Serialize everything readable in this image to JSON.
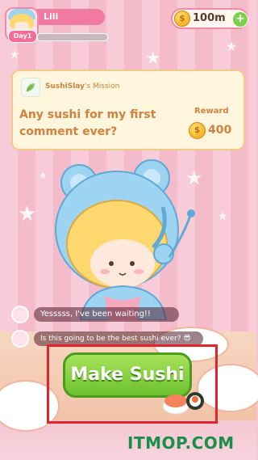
{
  "player": {
    "name": "Lili",
    "day": "Day1"
  },
  "currency": {
    "amount": "100m",
    "add_label": "+"
  },
  "mission": {
    "author": "SushiSlay",
    "title_suffix": "'s Mission",
    "text": "Any sushi for my first comment ever?",
    "reward_label": "Reward",
    "reward_value": "400"
  },
  "comments": [
    {
      "text": "Yesssss, I've been waiting!!"
    },
    {
      "text": "Is this going to be the best sushi ever? 😎"
    }
  ],
  "actions": {
    "make_sushi": "Make Sushi"
  },
  "watermark": "ITMOP.COM",
  "colors": {
    "accent": "#f07aa0",
    "button": "#7fcf4e",
    "mission_text": "#d2813f",
    "highlight": "#e2242b"
  }
}
